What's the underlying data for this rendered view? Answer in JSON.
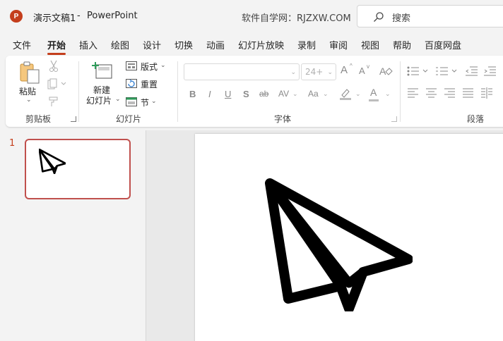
{
  "titlebar": {
    "doc_title": "演示文稿1",
    "separator": "-",
    "app_name": "PowerPoint",
    "watermark": "软件自学网：RJZXW.COM",
    "search_placeholder": "搜索",
    "app_logo_letter": "P"
  },
  "tabs": [
    "文件",
    "开始",
    "插入",
    "绘图",
    "设计",
    "切换",
    "动画",
    "幻灯片放映",
    "录制",
    "审阅",
    "视图",
    "帮助",
    "百度网盘"
  ],
  "active_tab": "开始",
  "ribbon": {
    "clipboard": {
      "paste_label": "粘贴",
      "paste_chevron": "⌄",
      "group_label": "剪贴板"
    },
    "slides": {
      "new_slide_line1": "新建",
      "new_slide_line2": "幻灯片",
      "new_slide_chevron": "⌄",
      "layout_label": "版式",
      "reset_label": "重置",
      "section_label": "节",
      "group_label": "幻灯片"
    },
    "font": {
      "font_name_value": "",
      "font_size_value": "24+",
      "grow_label": "A",
      "shrink_label": "A",
      "bold": "B",
      "italic": "I",
      "underline": "U",
      "shadow": "S",
      "strike": "ab",
      "spacing": "AV",
      "case": "Aa",
      "font_color": "A",
      "group_label": "字体"
    },
    "paragraph": {
      "group_label": "段落"
    }
  },
  "thumbnails": {
    "slides": [
      {
        "number": "1"
      }
    ]
  },
  "colors": {
    "accent": "#c43e1c",
    "thumb_border": "#c0504d"
  }
}
